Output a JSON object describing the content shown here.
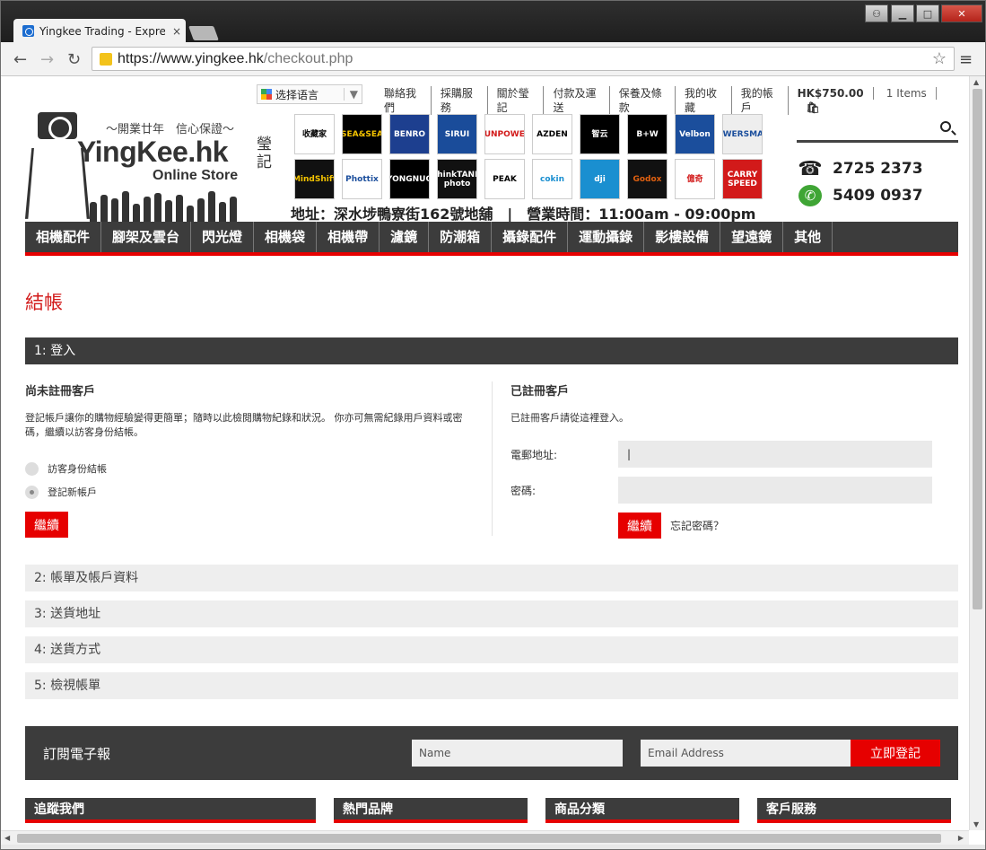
{
  "browser": {
    "tab_title": "Yingkee Trading - Expre",
    "tab_close": "×",
    "url_host": "https://www.yingkee.hk",
    "url_path": "/checkout.php",
    "star": "☆",
    "menu": "≡",
    "back": "←",
    "forward": "→",
    "reload": "↻",
    "win_min": "▁",
    "win_max": "□",
    "win_close": "✕",
    "win_user": "⚇"
  },
  "toplinks": {
    "language": "选择语言",
    "language_caret": "▼",
    "links": [
      "聯絡我們",
      "採購服務",
      "關於瑩記",
      "付款及運送",
      "保養及條款",
      "我的收藏",
      "我的帳戶"
    ],
    "cart_total": "HK$750.00",
    "cart_items": "1 Items",
    "cart_icon": "🛍"
  },
  "logo": {
    "slogan": "～開業廿年　信心保證～",
    "brand": "YingKee.hk",
    "chinese": "瑩記",
    "online": "Online Store"
  },
  "brands": [
    {
      "label": "收藏家",
      "bg": "#ffffff",
      "fg": "#000000"
    },
    {
      "label": "SEA&SEA",
      "bg": "#000000",
      "fg": "#f5c400"
    },
    {
      "label": "BENRO",
      "bg": "#1d3f8f",
      "fg": "#ffffff"
    },
    {
      "label": "SIRUI",
      "bg": "#1a4c9a",
      "fg": "#ffffff"
    },
    {
      "label": "SUNPOWER",
      "bg": "#ffffff",
      "fg": "#d21a1a"
    },
    {
      "label": "AZDEN",
      "bg": "#ffffff",
      "fg": "#000000"
    },
    {
      "label": "智云",
      "bg": "#000000",
      "fg": "#ffffff"
    },
    {
      "label": "B+W",
      "bg": "#000000",
      "fg": "#ffffff"
    },
    {
      "label": "Velbon",
      "bg": "#1b4e9c",
      "fg": "#ffffff"
    },
    {
      "label": "POWERSMART",
      "bg": "#eeeeee",
      "fg": "#1b4e9c"
    },
    {
      "label": "MindShift",
      "bg": "#111111",
      "fg": "#f5c400"
    },
    {
      "label": "Phottix",
      "bg": "#ffffff",
      "fg": "#1b4e9c"
    },
    {
      "label": "YONGNUO",
      "bg": "#000000",
      "fg": "#ffffff"
    },
    {
      "label": "thinkTANK photo",
      "bg": "#111111",
      "fg": "#ffffff"
    },
    {
      "label": "PEAK",
      "bg": "#ffffff",
      "fg": "#000000"
    },
    {
      "label": "cokin",
      "bg": "#ffffff",
      "fg": "#1a8fd0"
    },
    {
      "label": "dji",
      "bg": "#1a8fd0",
      "fg": "#ffffff"
    },
    {
      "label": "Godox",
      "bg": "#111111",
      "fg": "#e06010"
    },
    {
      "label": "億奇",
      "bg": "#ffffff",
      "fg": "#d21a1a"
    },
    {
      "label": "CARRY SPEED",
      "bg": "#d21a1a",
      "fg": "#ffffff"
    }
  ],
  "address": "地址：深水埗鴨寮街162號地舖　|　營業時間：11:00am - 09:00pm",
  "phones": [
    "2725 2373",
    "5409 0937"
  ],
  "phone_icons": [
    "☎",
    "✆"
  ],
  "nav": [
    "相機配件",
    "腳架及雲台",
    "閃光燈",
    "相機袋",
    "相機帶",
    "濾鏡",
    "防潮箱",
    "攝錄配件",
    "運動攝錄",
    "影樓設備",
    "望遠鏡",
    "其他"
  ],
  "page_title": "結帳",
  "steps": {
    "login": "1: 登入",
    "billing": "2: 帳單及帳戶資料",
    "shipping_address": "3: 送貨地址",
    "shipping_method": "4: 送貨方式",
    "review": "5: 檢視帳單"
  },
  "guest": {
    "heading": "尚未註冊客戶",
    "desc": "登記帳戶讓你的購物經驗變得更簡單；隨時以此檢閱購物紀錄和狀況。 你亦可無需紀錄用戶資料或密碼，繼續以訪客身份結帳。",
    "option_guest": "訪客身份結帳",
    "option_register": "登記新帳戶",
    "continue": "繼續"
  },
  "registered": {
    "heading": "已註冊客戶",
    "desc": "已註冊客戶請從這裡登入。",
    "email_label": "電郵地址:",
    "password_label": "密碼:",
    "continue": "繼續",
    "forgot": "忘記密碼？"
  },
  "newsletter": {
    "title": "訂閱電子報",
    "name_placeholder": "Name",
    "email_placeholder": "Email Address",
    "submit": "立即登記"
  },
  "footer": [
    "追蹤我們",
    "熱門品牌",
    "商品分類",
    "客戶服務"
  ]
}
